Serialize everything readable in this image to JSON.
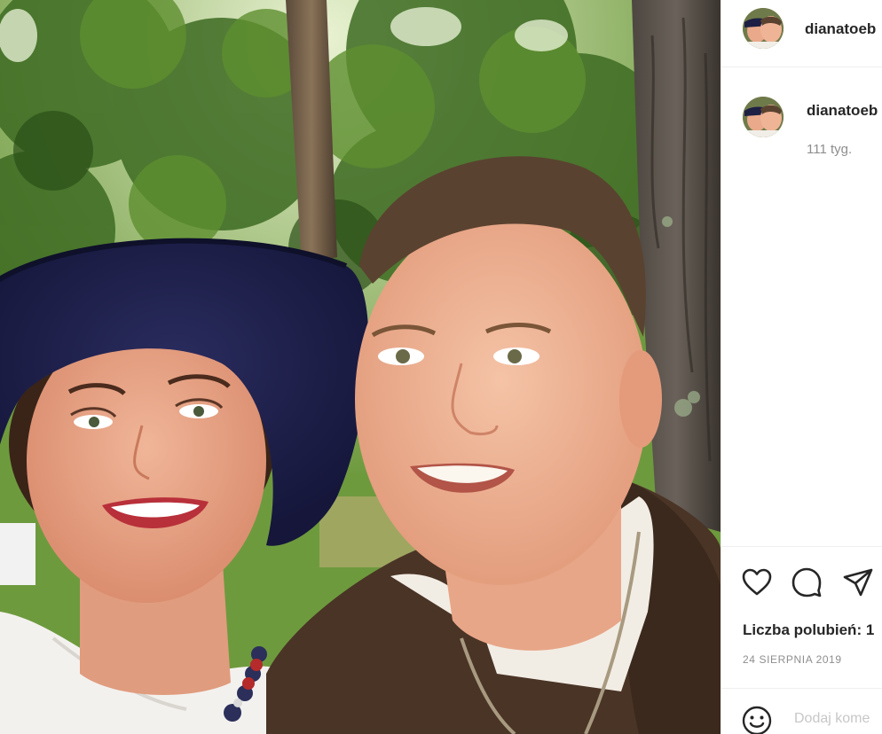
{
  "post": {
    "username": "dianatoeb",
    "caption_username": "dianatoeb",
    "caption_time": "111 tyg.",
    "likes_label": "Liczba polubień: 1",
    "date": "24 SIERPNIA 2019",
    "comment_placeholder": "Dodaj kome"
  },
  "icons": {
    "like": "heart-icon",
    "comment": "speech-bubble-icon",
    "share": "paper-plane-icon",
    "emoji": "smiley-icon"
  },
  "colors": {
    "text": "#262626",
    "muted": "#8e8e8e",
    "divider": "#efefef"
  },
  "photo": {
    "description_subject": "couple-selfie-in-forest"
  }
}
